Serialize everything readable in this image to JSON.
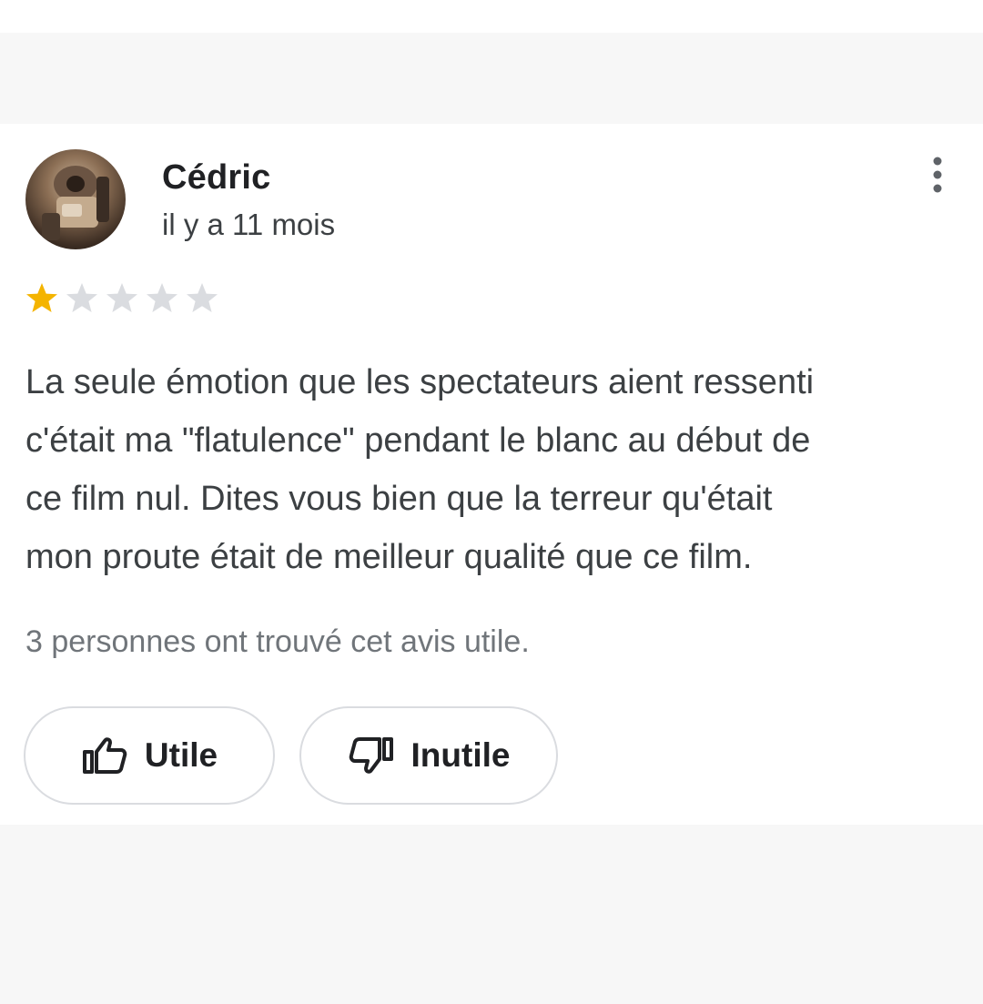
{
  "review": {
    "author_name": "Cédric",
    "time_ago": "il y a 11 mois",
    "rating": 1,
    "max_rating": 5,
    "text_lines": [
      "La seule émotion que les spectateurs aient ressenti",
      "c'était ma \"flatulence\" pendant le blanc au début de",
      "ce film nul. Dites vous bien que la terreur qu'était",
      "mon proute était de meilleur qualité que ce film."
    ],
    "helpful_count_text": "3 personnes ont trouvé cet avis utile."
  },
  "actions": {
    "useful_label": "Utile",
    "useless_label": "Inutile"
  },
  "icons": {
    "more": "more-vert-icon",
    "useful": "thumb-up-icon",
    "useless": "thumb-down-icon",
    "star": "star-icon"
  },
  "colors": {
    "star_filled": "#f4b400",
    "star_empty": "#dadce0",
    "text_primary": "#202124",
    "text_secondary": "#70757a",
    "button_border": "#dadce0"
  }
}
